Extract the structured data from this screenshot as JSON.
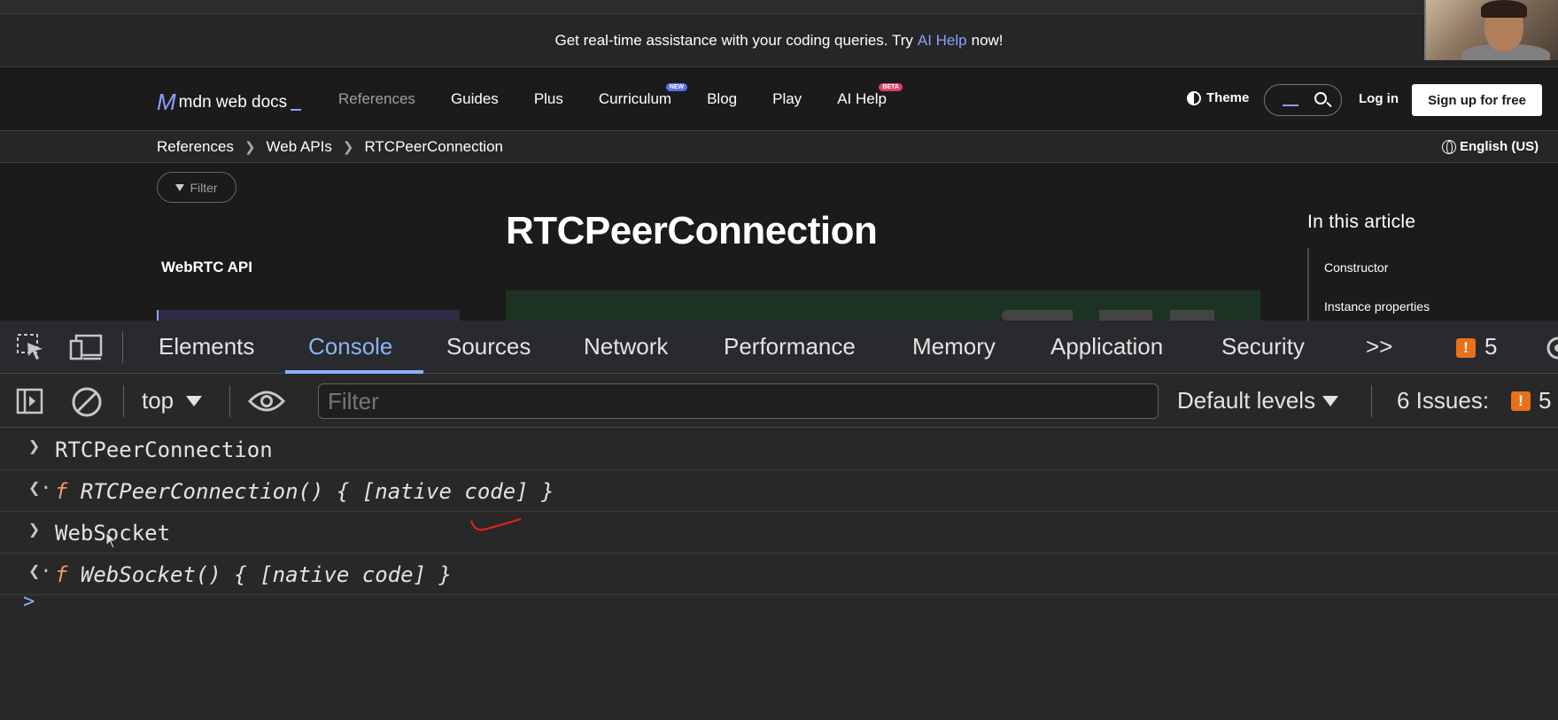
{
  "banner": {
    "prefix": "Get real-time assistance with your coding queries. Try",
    "link": "AI Help",
    "suffix": "now!"
  },
  "mdn_nav": {
    "logo_mark": "M",
    "logo_text": "mdn web docs",
    "items": [
      {
        "label": "References"
      },
      {
        "label": "Guides"
      },
      {
        "label": "Plus"
      },
      {
        "label": "Curriculum",
        "badge": "NEW"
      },
      {
        "label": "Blog"
      },
      {
        "label": "Play"
      },
      {
        "label": "AI Help",
        "badge": "BETA"
      }
    ],
    "theme_label": "Theme",
    "login_label": "Log in",
    "signup_label": "Sign up for free"
  },
  "breadcrumbs": [
    "References",
    "Web APIs",
    "RTCPeerConnection"
  ],
  "language": "English (US)",
  "sidebar": {
    "filter_label": "Filter",
    "title": "WebRTC API"
  },
  "article": {
    "title": "RTCPeerConnection"
  },
  "toc": {
    "title": "In this article",
    "items": [
      "Constructor",
      "Instance properties"
    ]
  },
  "devtools": {
    "tabs": [
      "Elements",
      "Console",
      "Sources",
      "Network",
      "Performance",
      "Memory",
      "Application",
      "Security"
    ],
    "active_tab": "Console",
    "more_tabs": ">>",
    "issues_badge_count": "5",
    "context": "top",
    "filter_placeholder": "Filter",
    "levels_label": "Default levels",
    "issues_label": "6 Issues:",
    "issues_count": "5",
    "accent_color": "#8ab4f8",
    "warning_color": "#e8711a"
  },
  "console": {
    "entries": [
      {
        "type": "input",
        "text": "RTCPeerConnection"
      },
      {
        "type": "output",
        "prefix": "f",
        "text": "RTCPeerConnection() { [native code] }"
      },
      {
        "type": "input",
        "text": "WebSocket"
      },
      {
        "type": "output",
        "prefix": "f",
        "text": "WebSocket() { [native code] }"
      }
    ],
    "prompt": ">"
  }
}
